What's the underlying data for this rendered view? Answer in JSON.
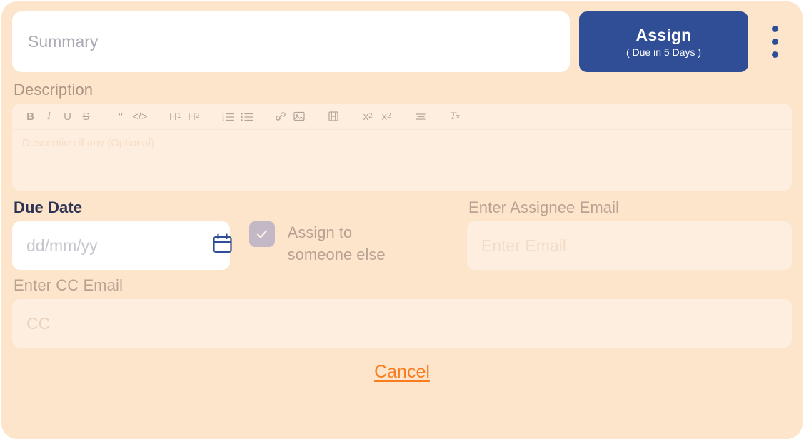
{
  "card": {
    "background_color": "#fde5cb",
    "accent_blue": "#2f4e96",
    "accent_orange": "#f97d20"
  },
  "summary": {
    "value": "",
    "placeholder": "Summary"
  },
  "assign_button": {
    "main_label": "Assign",
    "sub_label": "( Due in 5 Days )"
  },
  "kebab_menu": {
    "name": "more-options"
  },
  "description": {
    "label": "Description",
    "value": "",
    "placeholder": "Description if any (Optional)",
    "toolbar": [
      {
        "name": "bold-icon",
        "glyph": "B"
      },
      {
        "name": "italic-icon",
        "glyph": "I"
      },
      {
        "name": "underline-icon",
        "glyph": "U"
      },
      {
        "name": "strikethrough-icon",
        "glyph": "S"
      },
      {
        "name": "blockquote-icon",
        "glyph": "”"
      },
      {
        "name": "code-block-icon",
        "glyph": "</>"
      },
      {
        "name": "heading-1-icon",
        "glyph": "H1"
      },
      {
        "name": "heading-2-icon",
        "glyph": "H2"
      },
      {
        "name": "ordered-list-icon",
        "glyph": "ordered-list"
      },
      {
        "name": "bullet-list-icon",
        "glyph": "bullet-list"
      },
      {
        "name": "link-icon",
        "glyph": "link"
      },
      {
        "name": "image-icon",
        "glyph": "image"
      },
      {
        "name": "video-icon",
        "glyph": "video"
      },
      {
        "name": "subscript-icon",
        "glyph": "x2"
      },
      {
        "name": "superscript-icon",
        "glyph": "x^2"
      },
      {
        "name": "align-icon",
        "glyph": "align"
      },
      {
        "name": "clear-format-icon",
        "glyph": "Tx"
      }
    ]
  },
  "due_date": {
    "label": "Due Date",
    "value": "",
    "placeholder": "dd/mm/yy",
    "icon": "calendar-icon"
  },
  "assign_someone": {
    "checked": true,
    "label_line_1": "Assign to",
    "label_line_2": "someone else"
  },
  "assignee_email": {
    "label": "Enter Assignee Email",
    "value": "",
    "placeholder": "Enter Email"
  },
  "cc_email": {
    "label": "Enter CC Email",
    "value": "",
    "placeholder": "CC"
  },
  "cancel": {
    "label": "Cancel"
  }
}
